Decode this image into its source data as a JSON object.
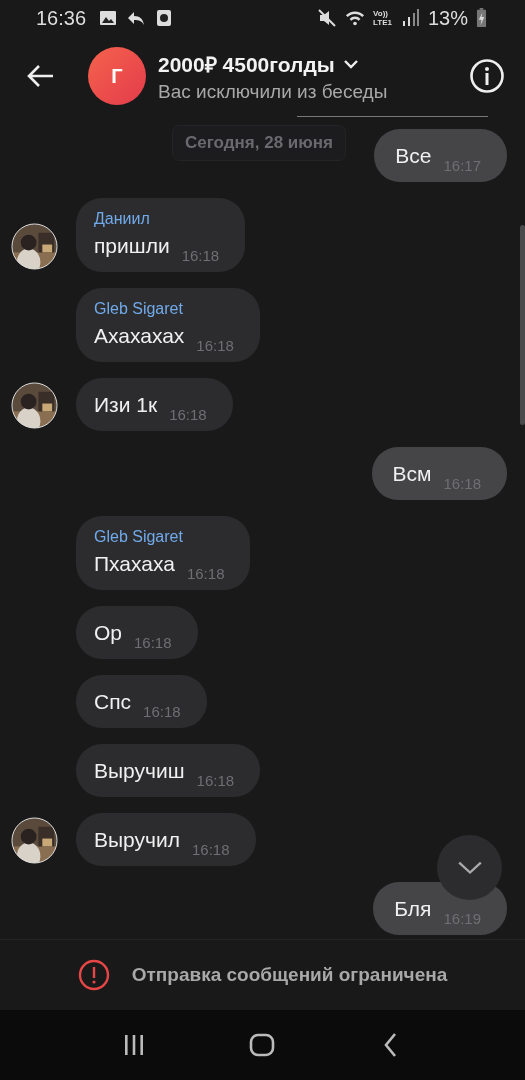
{
  "status_bar": {
    "time": "16:36",
    "volte": "Vo))",
    "network": "LTE1",
    "battery": "13%"
  },
  "header": {
    "avatar_letter": "Г",
    "title": "2000₽ 4500голды",
    "subtitle": "Вас исключили из беседы"
  },
  "date_chip": "Сегодня, 28 июня",
  "messages": [
    {
      "kind": "outgoing",
      "text": "Все",
      "time": "16:17",
      "avatar": false
    },
    {
      "kind": "incoming",
      "sender": "Даниил",
      "text": "пришли",
      "time": "16:18",
      "avatar": true
    },
    {
      "kind": "incoming",
      "sender": "Gleb Sigaret",
      "text": "Ахахахах",
      "time": "16:18",
      "avatar": false
    },
    {
      "kind": "incoming",
      "text": "Изи 1к",
      "time": "16:18",
      "avatar": true
    },
    {
      "kind": "outgoing",
      "text": "Всм",
      "time": "16:18",
      "avatar": false
    },
    {
      "kind": "incoming",
      "sender": "Gleb Sigaret",
      "text": "Пхахаха",
      "time": "16:18",
      "avatar": false
    },
    {
      "kind": "incoming",
      "text": "Ор",
      "time": "16:18",
      "avatar": false
    },
    {
      "kind": "incoming",
      "text": "Спс",
      "time": "16:18",
      "avatar": false
    },
    {
      "kind": "incoming",
      "text": "Выручиш",
      "time": "16:18",
      "avatar": false
    },
    {
      "kind": "incoming",
      "text": "Выручил",
      "time": "16:18",
      "avatar": true
    },
    {
      "kind": "outgoing",
      "text": "Бля",
      "time": "16:19",
      "avatar": false
    }
  ],
  "restriction_notice": "Отправка сообщений ограничена"
}
